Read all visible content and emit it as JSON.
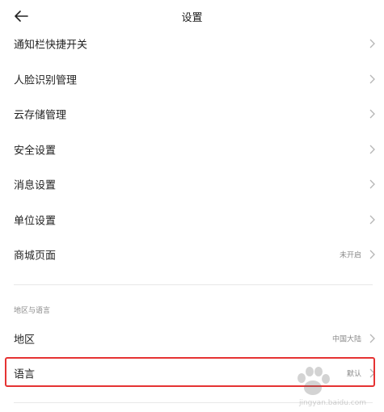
{
  "header": {
    "title": "设置",
    "back_icon": "arrow-left-icon"
  },
  "settings": [
    {
      "label": "通知栏快捷开关",
      "value": ""
    },
    {
      "label": "人脸识别管理",
      "value": ""
    },
    {
      "label": "云存储管理",
      "value": ""
    },
    {
      "label": "安全设置",
      "value": ""
    },
    {
      "label": "消息设置",
      "value": ""
    },
    {
      "label": "单位设置",
      "value": ""
    },
    {
      "label": "商城页面",
      "value": "未开启"
    }
  ],
  "region_section": {
    "title": "地区与语言",
    "items": [
      {
        "label": "地区",
        "value": "中国大陆"
      },
      {
        "label": "语言",
        "value": "默认"
      }
    ]
  },
  "watermark": {
    "text": "jingyan.baidu.com"
  },
  "colors": {
    "highlight": "#e53333",
    "chevron": "#b5b5b5",
    "secondary_text": "#8a8a8a"
  }
}
